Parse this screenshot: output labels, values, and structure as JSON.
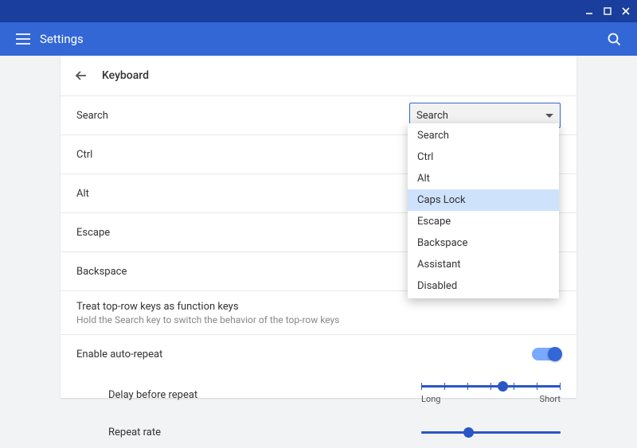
{
  "window": {
    "minimize": "",
    "maximize": "",
    "close": ""
  },
  "appbar": {
    "title": "Settings"
  },
  "page": {
    "title": "Keyboard"
  },
  "rows": {
    "search": "Search",
    "ctrl": "Ctrl",
    "alt": "Alt",
    "escape": "Escape",
    "backspace": "Backspace",
    "toprow": "Treat top-row keys as function keys",
    "toprow_sub": "Hold the Search key to switch the behavior of the top-row keys",
    "auto_repeat": "Enable auto-repeat",
    "delay": "Delay before repeat",
    "rate": "Repeat rate"
  },
  "dropdown": {
    "selected": "Search",
    "options": [
      "Search",
      "Ctrl",
      "Alt",
      "Caps Lock",
      "Escape",
      "Backspace",
      "Assistant",
      "Disabled"
    ],
    "highlighted_index": 3
  },
  "slider_delay": {
    "min_label": "Long",
    "max_label": "Short",
    "position_pct": 55
  },
  "slider_rate": {
    "position_pct": 30
  },
  "toggle": {
    "auto_repeat_on": true
  },
  "colors": {
    "accent": "#3367d6"
  }
}
